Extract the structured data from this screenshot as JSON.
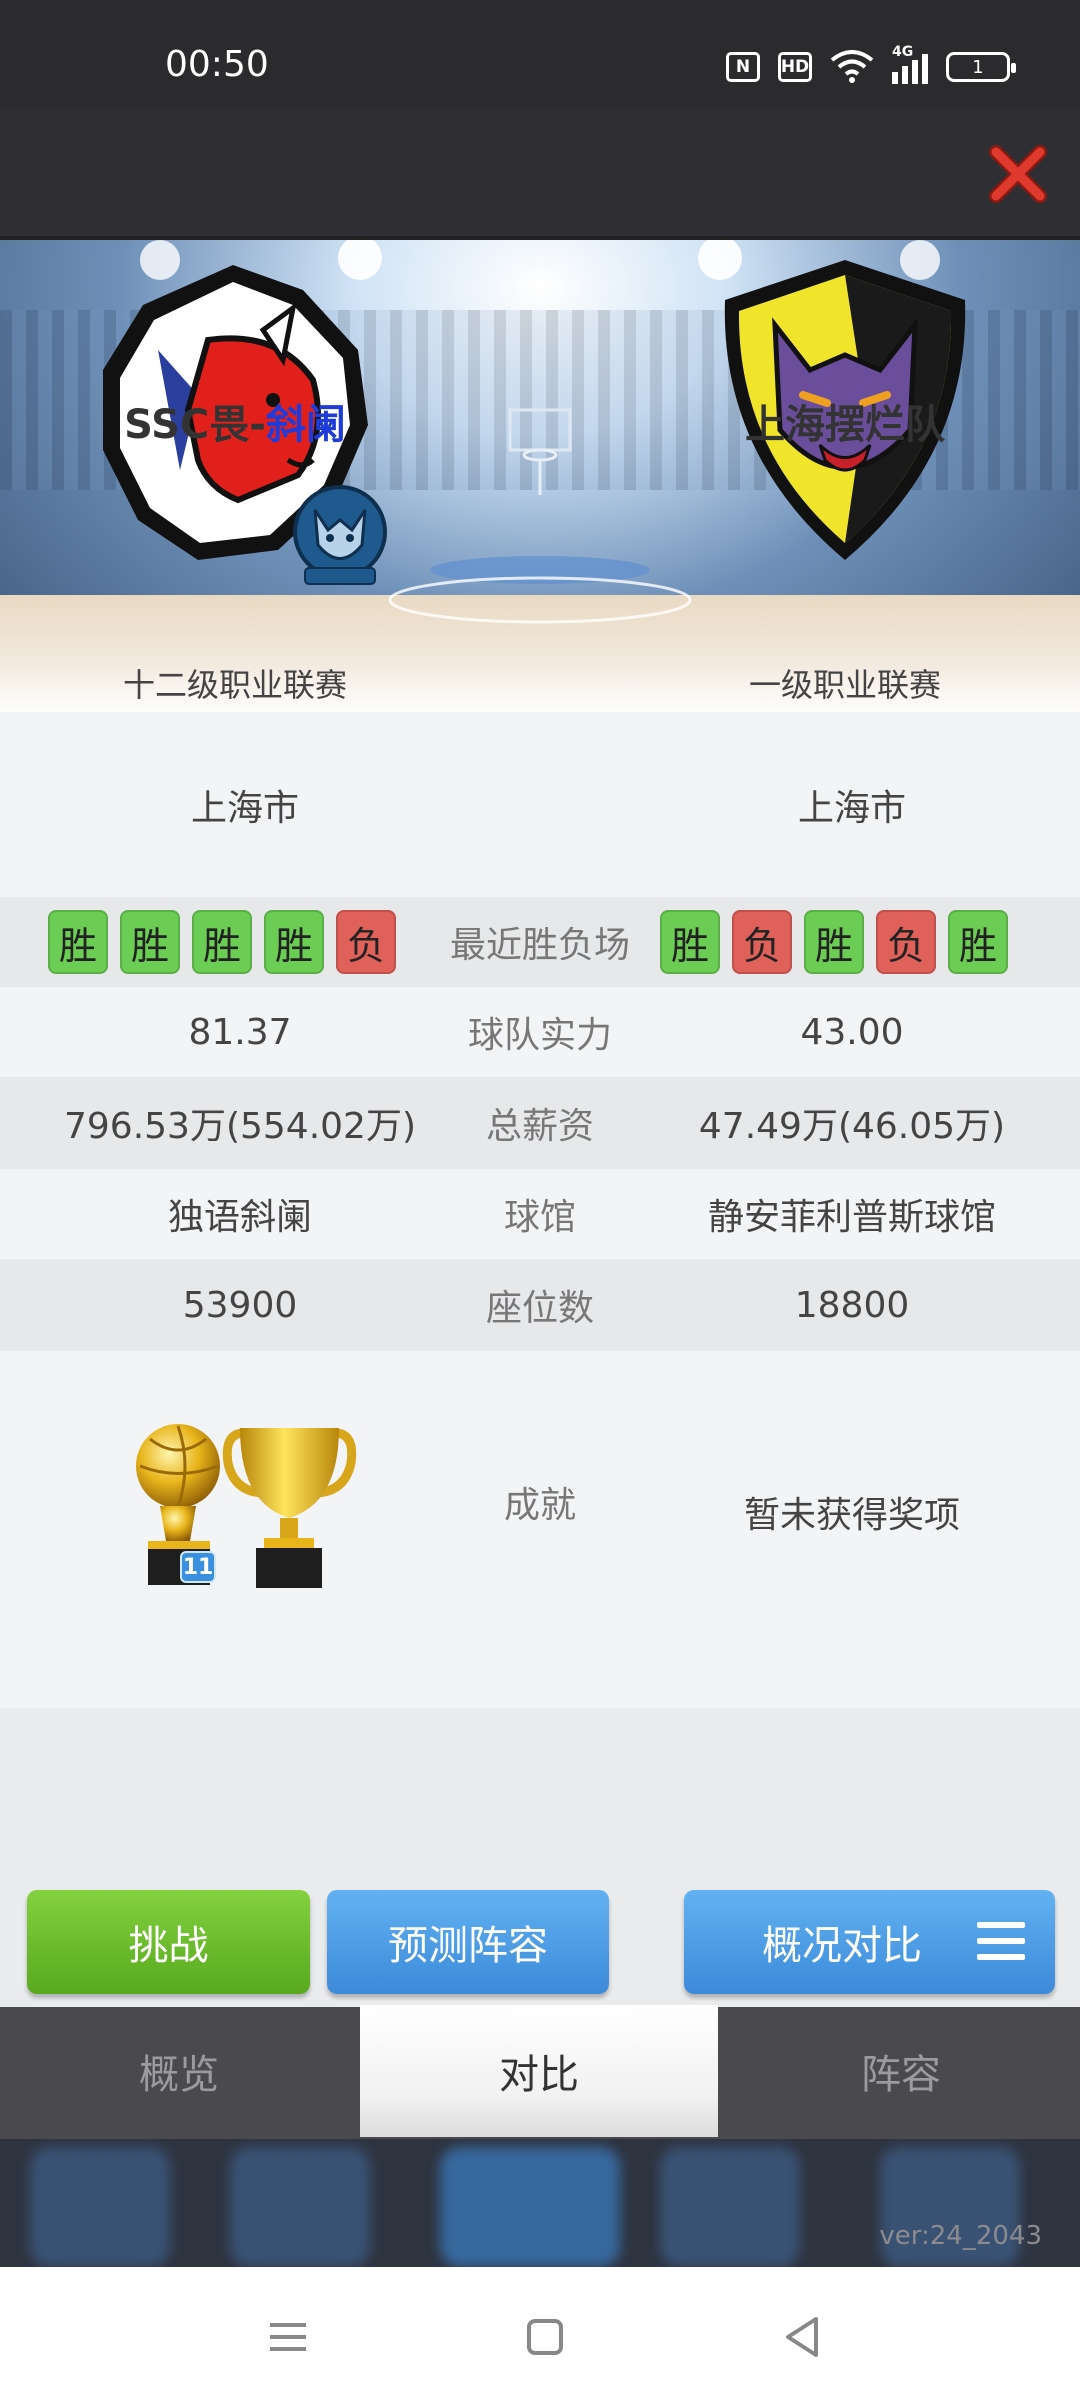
{
  "status_bar": {
    "time": "00:50",
    "nfc": "N",
    "hd": "HD",
    "network": "4G",
    "battery": "1"
  },
  "header": {
    "close_icon": "close-x-icon",
    "close_color": "#e03a2e"
  },
  "teams": {
    "left": {
      "name_prefix": "SSC畏-",
      "name_accent": "斜阑",
      "league": "十二级职业联赛"
    },
    "right": {
      "name": "上海摆烂队",
      "league": "一级职业联赛"
    }
  },
  "comparison": {
    "city": {
      "left": "上海市",
      "right": "上海市"
    },
    "recent": {
      "label": "最近胜负场",
      "left": [
        "胜",
        "胜",
        "胜",
        "胜",
        "负"
      ],
      "right": [
        "胜",
        "负",
        "胜",
        "负",
        "胜"
      ]
    },
    "strength": {
      "label": "球队实力",
      "left": "81.37",
      "right": "43.00"
    },
    "salary": {
      "label": "总薪资",
      "left": "796.53万(554.02万)",
      "right": "47.49万(46.05万)"
    },
    "arena": {
      "label": "球馆",
      "left": "独语斜阑",
      "right": "静安菲利普斯球馆"
    },
    "seats": {
      "label": "座位数",
      "left": "53900",
      "right": "18800"
    },
    "achievements": {
      "label": "成就",
      "left_trophy_count": "11",
      "right": "暂未获得奖项"
    }
  },
  "actions": {
    "challenge": "挑战",
    "predict_lineup": "预测阵容",
    "overview_compare": "概况对比"
  },
  "tabs": {
    "overview": "概览",
    "compare": "对比",
    "lineup": "阵容",
    "active": "compare"
  },
  "footer": {
    "version": "ver:24_2043"
  },
  "colors": {
    "win": "#6ccd55",
    "loss": "#e0605a",
    "accent_blue": "#1f3bd9"
  }
}
